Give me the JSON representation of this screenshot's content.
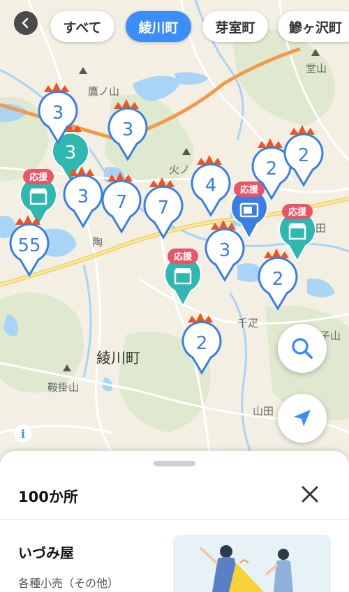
{
  "filters": {
    "back_icon": "chevron-left-icon",
    "items": [
      {
        "label": "すべて",
        "active": false
      },
      {
        "label": "綾川町",
        "active": true
      },
      {
        "label": "芽室町",
        "active": false
      },
      {
        "label": "鰺ヶ沢町",
        "active": false
      }
    ]
  },
  "map": {
    "labels": {
      "mountain_1": "鷹ノ山",
      "mountain_2": "堂山",
      "mountain_3": "火ノ",
      "mountain_4": "鞍掛山",
      "area_1": "陶",
      "area_2": "千疋",
      "area_3": "山田",
      "area_4": "田",
      "area_5": "子山",
      "town": "綾川町"
    },
    "support_label": "応援",
    "clusters": [
      "3",
      "3",
      "3",
      "3",
      "7",
      "7",
      "4",
      "2",
      "2",
      "55",
      "3",
      "2",
      "2"
    ]
  },
  "buttons": {
    "search_icon": "search-icon",
    "location_icon": "location-arrow-icon",
    "info_label": "i"
  },
  "sheet": {
    "count_label": "100か所",
    "close_icon": "close-icon",
    "shop": {
      "name": "いづみ屋",
      "category": "各種小売（その他）"
    }
  },
  "colors": {
    "accent": "#3a8ef6",
    "pin_blue": "#3a7fe0",
    "pin_teal": "#2fb7b0",
    "support_red": "#e8556a",
    "crown_orange": "#f0531f"
  }
}
